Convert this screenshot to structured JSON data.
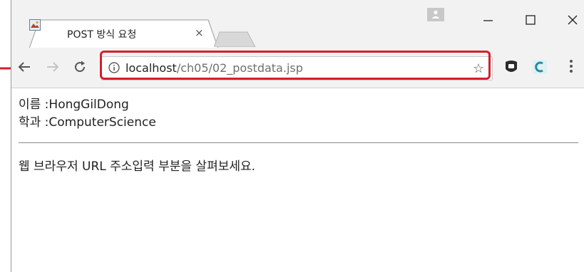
{
  "tab": {
    "title": "POST 방식 요청",
    "close": "×"
  },
  "window_controls": {
    "minimize": "—",
    "maximize": "☐",
    "close": "×"
  },
  "address": {
    "host": "localhost",
    "path": "/ch05/02_postdata.jsp"
  },
  "content": {
    "name_line": "이름 :HongGilDong",
    "dept_line": "학과 :ComputerScience",
    "message": "웹 브라우저 URL 주소입력 부분을 살펴보세요."
  },
  "colors": {
    "highlight": "#d4202a",
    "chrome_bg": "#f2f2f2"
  },
  "icons": [
    "favicon-icon",
    "profile-icon",
    "back-icon",
    "forward-icon",
    "reload-icon",
    "info-icon",
    "star-icon",
    "extension-icon",
    "menu-icon"
  ]
}
